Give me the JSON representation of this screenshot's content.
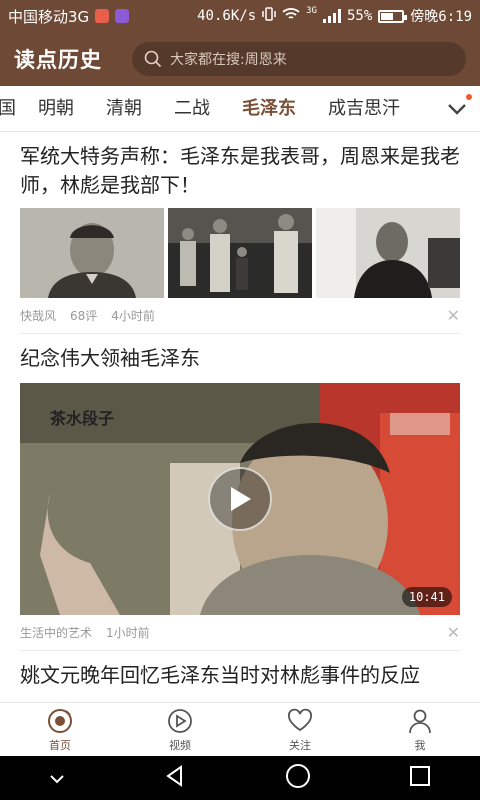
{
  "status_bar": {
    "carrier": "中国移动3G",
    "speed": "40.6K/s",
    "battery": "55%",
    "time": "傍晚6:19",
    "network_label": "3G",
    "colors": {
      "mail_badge": "#e8604c",
      "gallery_badge": "#8e5bd6"
    }
  },
  "header": {
    "logo": "读点历史",
    "search_placeholder": "大家都在搜:周恩来"
  },
  "tabs": {
    "partial_label": "国",
    "items": [
      "明朝",
      "清朝",
      "二战",
      "毛泽东",
      "成吉思汗"
    ],
    "active_index": 3
  },
  "feed": {
    "articles": [
      {
        "title": "军统大特务声称：毛泽东是我表哥，周恩来是我老师，林彪是我部下！",
        "source": "快哉风",
        "comments": "68评",
        "time": "4小时前"
      },
      {
        "title": "纪念伟大领袖毛泽东",
        "source": "生活中的艺术",
        "time": "1小时前",
        "duration": "10:41",
        "watermark": "茶水段子"
      },
      {
        "title": "姚文元晚年回忆毛泽东当时对林彪事件的反应"
      }
    ]
  },
  "bottom_nav": {
    "items": [
      "首页",
      "视频",
      "关注",
      "我"
    ],
    "active_index": 0
  },
  "theme": {
    "primary": "#6e4a36",
    "accent": "#7a4f37",
    "badge_dot": "#f05a28"
  }
}
